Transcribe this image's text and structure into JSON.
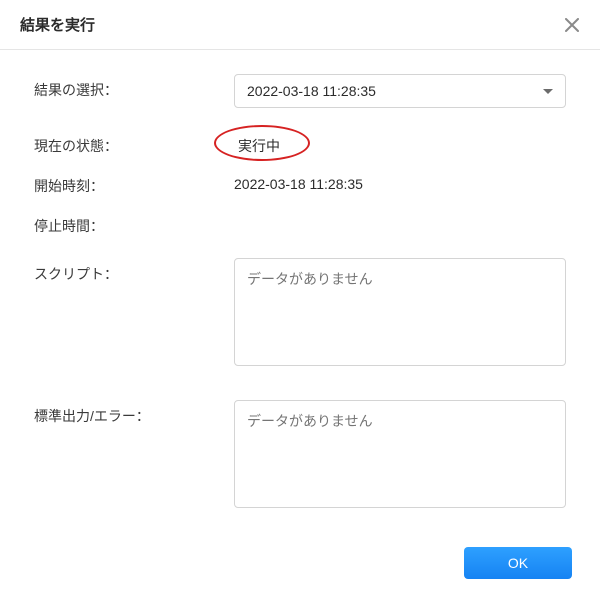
{
  "dialog": {
    "title": "結果を実行",
    "ok_label": "OK"
  },
  "fields": {
    "select_result_label": "結果の選択：",
    "select_result_value": "2022-03-18 11:28:35",
    "status_label": "現在の状態：",
    "status_value": "実行中",
    "start_time_label": "開始時刻：",
    "start_time_value": "2022-03-18 11:28:35",
    "stop_time_label": "停止時間：",
    "stop_time_value": "",
    "script_label": "スクリプト：",
    "script_placeholder": "データがありません",
    "stdout_label": "標準出力/エラー：",
    "stdout_placeholder": "データがありません"
  }
}
